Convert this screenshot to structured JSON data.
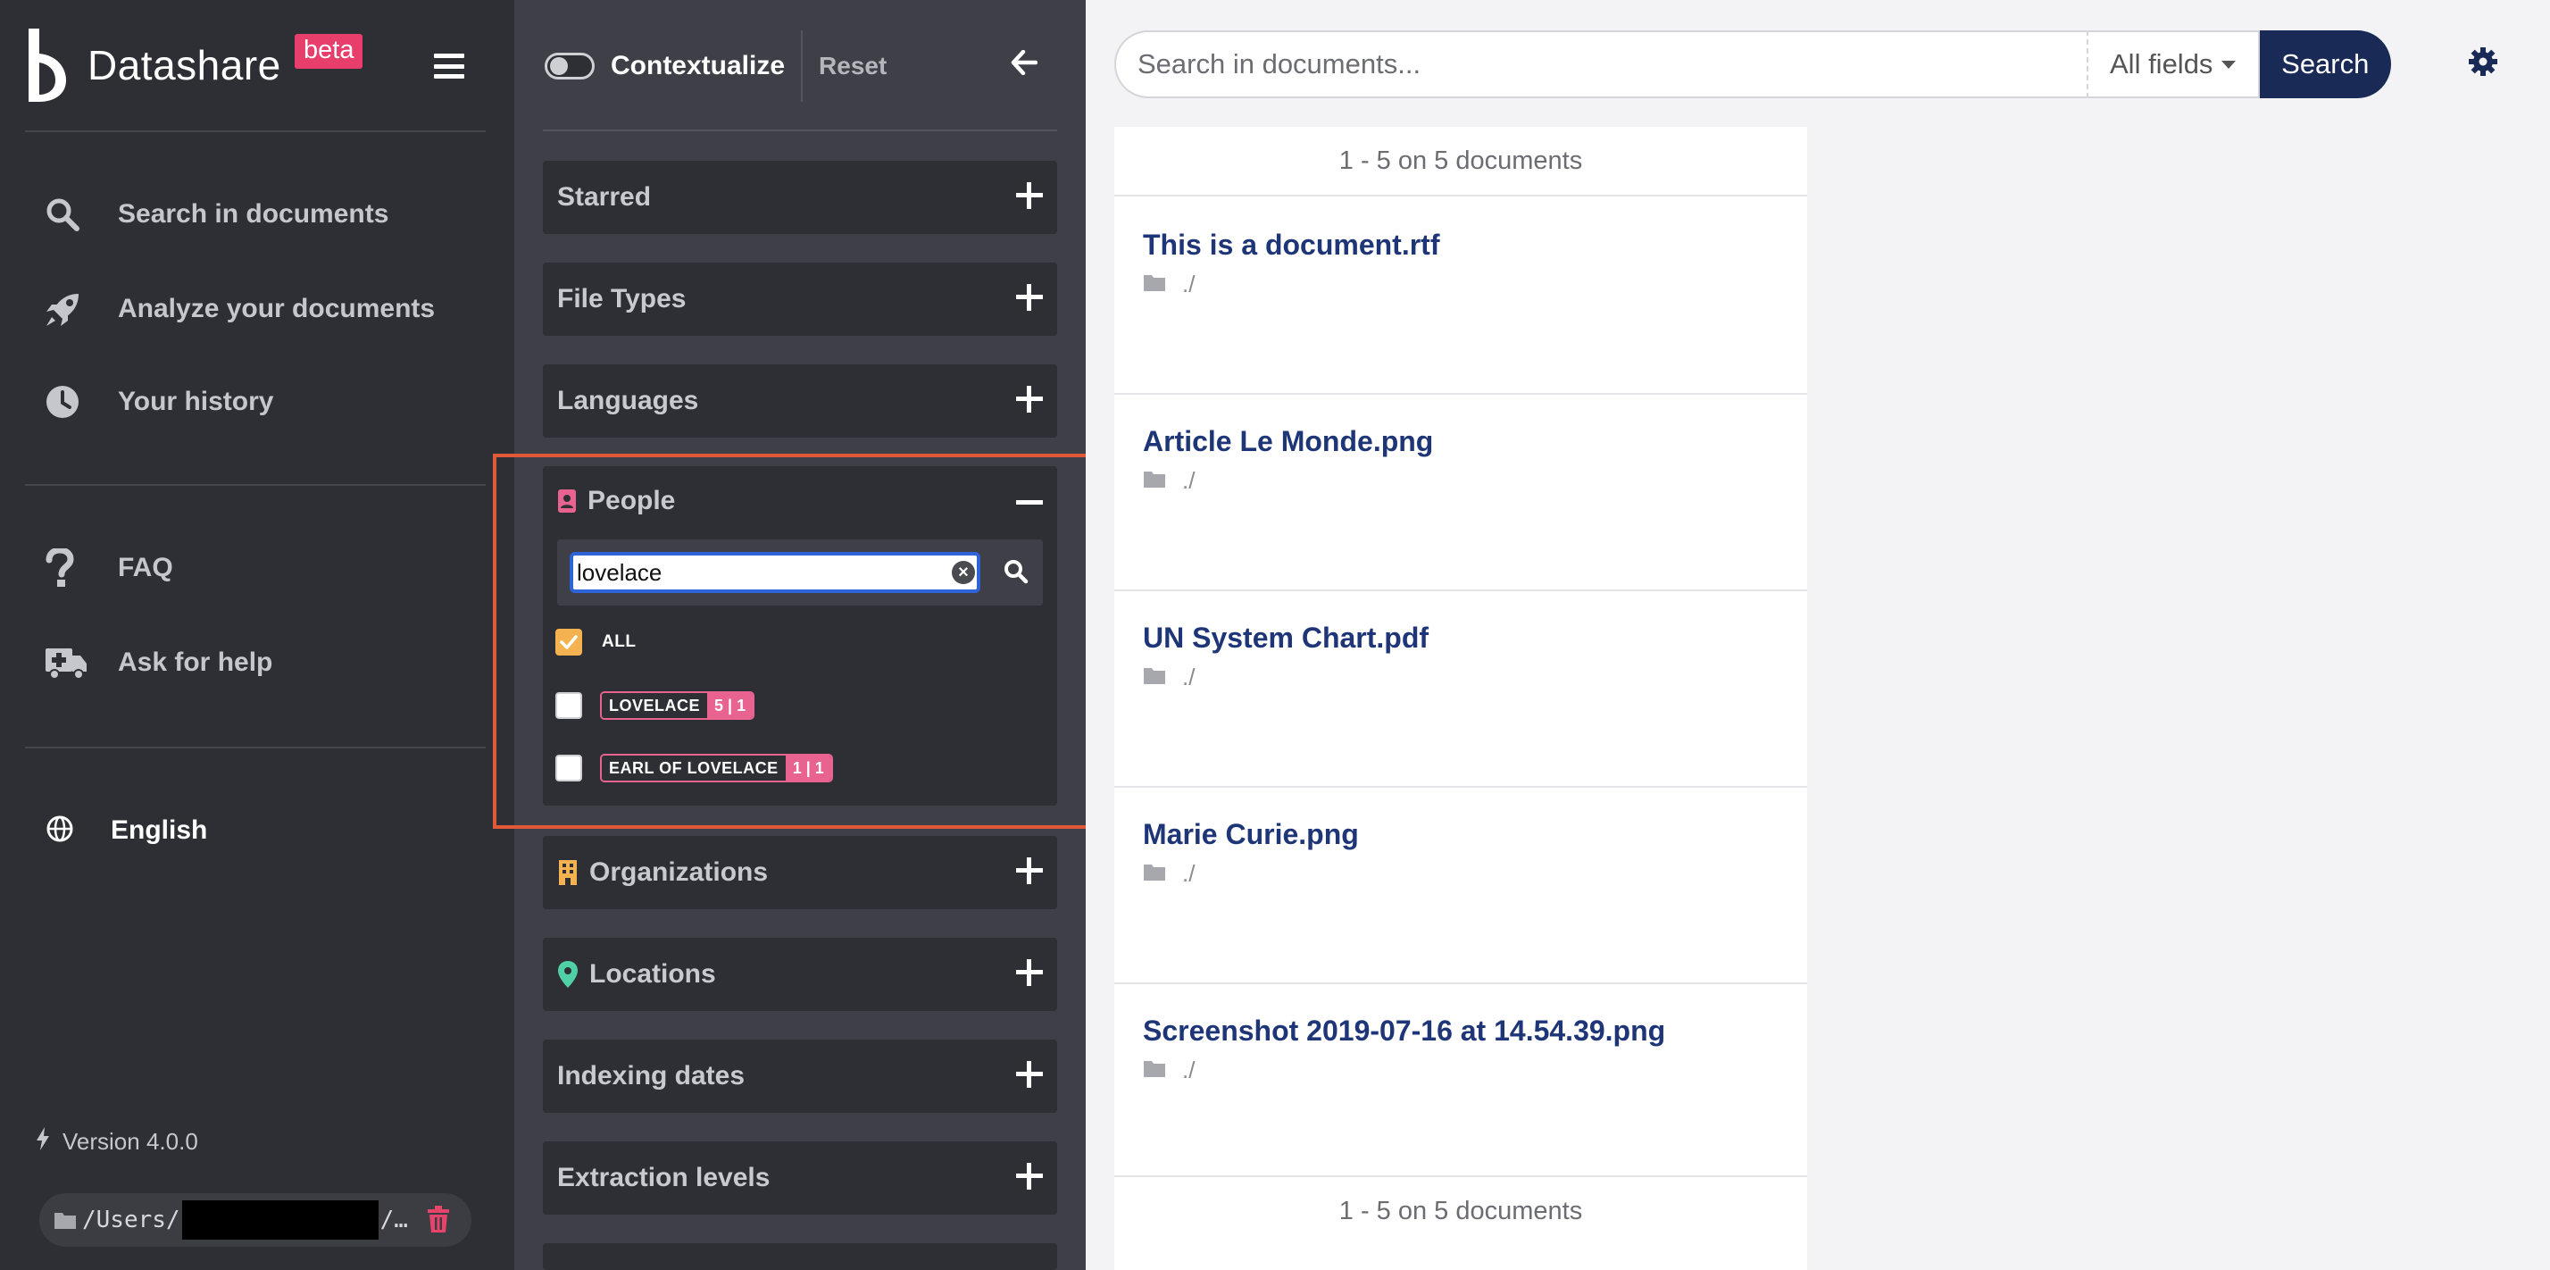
{
  "app": {
    "name": "Datashare",
    "badge": "beta"
  },
  "nav": {
    "items": [
      {
        "label": "Search in documents",
        "icon": "search-icon"
      },
      {
        "label": "Analyze your documents",
        "icon": "rocket-icon"
      },
      {
        "label": "Your history",
        "icon": "clock-icon"
      },
      {
        "label": "FAQ",
        "icon": "question-icon"
      },
      {
        "label": "Ask for help",
        "icon": "ambulance-icon"
      }
    ],
    "language": "English",
    "version": "Version 4.0.0",
    "path_prefix": "/Users/",
    "path_suffix": "/…"
  },
  "filters": {
    "contextualize_label": "Contextualize",
    "contextualize_on": false,
    "reset_label": "Reset",
    "cards": [
      {
        "label": "Starred"
      },
      {
        "label": "File Types"
      },
      {
        "label": "Languages"
      },
      {
        "label": "Organizations",
        "icon": "building-icon"
      },
      {
        "label": "Locations",
        "icon": "map-marker-icon"
      },
      {
        "label": "Indexing dates"
      },
      {
        "label": "Extraction levels"
      }
    ],
    "people": {
      "label": "People",
      "search_value": "lovelace",
      "all_label": "ALL",
      "all_checked": true,
      "options": [
        {
          "name": "LOVELACE",
          "count": "5 | 1",
          "checked": false
        },
        {
          "name": "EARL OF LOVELACE",
          "count": "1 | 1",
          "checked": false
        }
      ]
    }
  },
  "search": {
    "placeholder": "Search in documents...",
    "value": "",
    "fields_label": "All fields",
    "button_label": "Search"
  },
  "results": {
    "summary": "1 - 5  on 5 documents",
    "documents": [
      {
        "title": "This is a document.rtf",
        "path": "./"
      },
      {
        "title": "Article Le Monde.png",
        "path": "./"
      },
      {
        "title": "UN System Chart.pdf",
        "path": "./"
      },
      {
        "title": "Marie Curie.png",
        "path": "./"
      },
      {
        "title": "Screenshot 2019-07-16 at 14.54.39.png",
        "path": "./"
      }
    ]
  },
  "colors": {
    "nav_bg": "#2e2f35",
    "filters_bg": "#3f4047",
    "accent_pink": "#e8638f",
    "search_button": "#1a2a56",
    "doc_title": "#1e3577",
    "highlight": "#e05a3a",
    "check": "#f4b350"
  }
}
